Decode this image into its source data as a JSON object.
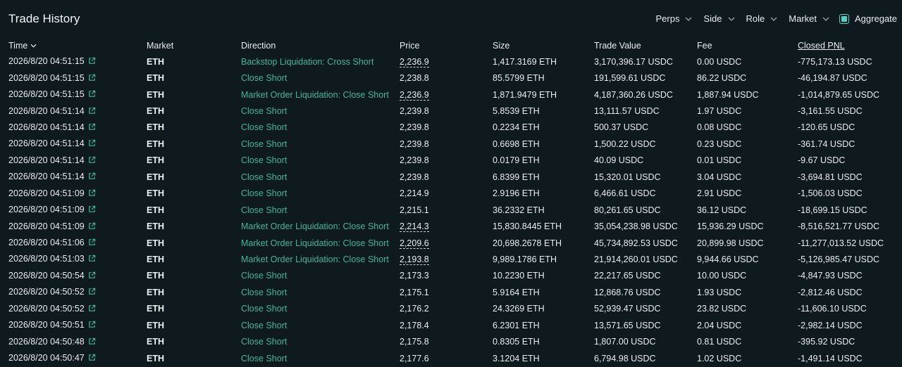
{
  "header": {
    "title": "Trade History",
    "filters": [
      "Perps",
      "Side",
      "Role",
      "Market"
    ],
    "aggregate_label": "Aggregate",
    "aggregate_checked": true
  },
  "columns": [
    "Time",
    "Market",
    "Direction",
    "Price",
    "Size",
    "Trade Value",
    "Fee",
    "Closed PNL"
  ],
  "rows": [
    {
      "time": "2026/8/20 04:51:15",
      "market": "ETH",
      "direction": "Backstop Liquidation: Cross Short",
      "price": "2,236.9",
      "price_dashed": true,
      "size": "1,417.3169 ETH",
      "value": "3,170,396.17 USDC",
      "fee": "0.00 USDC",
      "pnl": "-775,173.13 USDC"
    },
    {
      "time": "2026/8/20 04:51:15",
      "market": "ETH",
      "direction": "Close Short",
      "price": "2,238.8",
      "price_dashed": false,
      "size": "85.5799 ETH",
      "value": "191,599.61 USDC",
      "fee": "86.22 USDC",
      "pnl": "-46,194.87 USDC"
    },
    {
      "time": "2026/8/20 04:51:15",
      "market": "ETH",
      "direction": "Market Order Liquidation: Close Short",
      "price": "2,236.9",
      "price_dashed": true,
      "size": "1,871.9479 ETH",
      "value": "4,187,360.26 USDC",
      "fee": "1,887.94 USDC",
      "pnl": "-1,014,879.65 USDC"
    },
    {
      "time": "2026/8/20 04:51:14",
      "market": "ETH",
      "direction": "Close Short",
      "price": "2,239.8",
      "price_dashed": false,
      "size": "5.8539 ETH",
      "value": "13,111.57 USDC",
      "fee": "1.97 USDC",
      "pnl": "-3,161.55 USDC"
    },
    {
      "time": "2026/8/20 04:51:14",
      "market": "ETH",
      "direction": "Close Short",
      "price": "2,239.8",
      "price_dashed": false,
      "size": "0.2234 ETH",
      "value": "500.37 USDC",
      "fee": "0.08 USDC",
      "pnl": "-120.65 USDC"
    },
    {
      "time": "2026/8/20 04:51:14",
      "market": "ETH",
      "direction": "Close Short",
      "price": "2,239.8",
      "price_dashed": false,
      "size": "0.6698 ETH",
      "value": "1,500.22 USDC",
      "fee": "0.23 USDC",
      "pnl": "-361.74 USDC"
    },
    {
      "time": "2026/8/20 04:51:14",
      "market": "ETH",
      "direction": "Close Short",
      "price": "2,239.8",
      "price_dashed": false,
      "size": "0.0179 ETH",
      "value": "40.09 USDC",
      "fee": "0.01 USDC",
      "pnl": "-9.67 USDC"
    },
    {
      "time": "2026/8/20 04:51:14",
      "market": "ETH",
      "direction": "Close Short",
      "price": "2,239.8",
      "price_dashed": false,
      "size": "6.8399 ETH",
      "value": "15,320.01 USDC",
      "fee": "3.04 USDC",
      "pnl": "-3,694.81 USDC"
    },
    {
      "time": "2026/8/20 04:51:09",
      "market": "ETH",
      "direction": "Close Short",
      "price": "2,214.9",
      "price_dashed": false,
      "size": "2.9196 ETH",
      "value": "6,466.61 USDC",
      "fee": "2.91 USDC",
      "pnl": "-1,506.03 USDC"
    },
    {
      "time": "2026/8/20 04:51:09",
      "market": "ETH",
      "direction": "Close Short",
      "price": "2,215.1",
      "price_dashed": false,
      "size": "36.2332 ETH",
      "value": "80,261.65 USDC",
      "fee": "36.12 USDC",
      "pnl": "-18,699.15 USDC"
    },
    {
      "time": "2026/8/20 04:51:09",
      "market": "ETH",
      "direction": "Market Order Liquidation: Close Short",
      "price": "2,214.3",
      "price_dashed": true,
      "size": "15,830.8445 ETH",
      "value": "35,054,238.98 USDC",
      "fee": "15,936.29 USDC",
      "pnl": "-8,516,521.77 USDC"
    },
    {
      "time": "2026/8/20 04:51:06",
      "market": "ETH",
      "direction": "Market Order Liquidation: Close Short",
      "price": "2,209.6",
      "price_dashed": true,
      "size": "20,698.2678 ETH",
      "value": "45,734,892.53 USDC",
      "fee": "20,899.98 USDC",
      "pnl": "-11,277,013.52 USDC"
    },
    {
      "time": "2026/8/20 04:51:03",
      "market": "ETH",
      "direction": "Market Order Liquidation: Close Short",
      "price": "2,193.8",
      "price_dashed": true,
      "size": "9,989.1786 ETH",
      "value": "21,914,260.01 USDC",
      "fee": "9,944.66 USDC",
      "pnl": "-5,126,985.47 USDC"
    },
    {
      "time": "2026/8/20 04:50:54",
      "market": "ETH",
      "direction": "Close Short",
      "price": "2,173.3",
      "price_dashed": false,
      "size": "10.2230 ETH",
      "value": "22,217.65 USDC",
      "fee": "10.00 USDC",
      "pnl": "-4,847.93 USDC"
    },
    {
      "time": "2026/8/20 04:50:52",
      "market": "ETH",
      "direction": "Close Short",
      "price": "2,175.1",
      "price_dashed": false,
      "size": "5.9164 ETH",
      "value": "12,868.76 USDC",
      "fee": "1.93 USDC",
      "pnl": "-2,812.46 USDC"
    },
    {
      "time": "2026/8/20 04:50:52",
      "market": "ETH",
      "direction": "Close Short",
      "price": "2,176.2",
      "price_dashed": false,
      "size": "24.3269 ETH",
      "value": "52,939.47 USDC",
      "fee": "23.82 USDC",
      "pnl": "-11,606.10 USDC"
    },
    {
      "time": "2026/8/20 04:50:51",
      "market": "ETH",
      "direction": "Close Short",
      "price": "2,178.4",
      "price_dashed": false,
      "size": "6.2301 ETH",
      "value": "13,571.65 USDC",
      "fee": "2.04 USDC",
      "pnl": "-2,982.14 USDC"
    },
    {
      "time": "2026/8/20 04:50:48",
      "market": "ETH",
      "direction": "Close Short",
      "price": "2,175.8",
      "price_dashed": false,
      "size": "0.8305 ETH",
      "value": "1,807.00 USDC",
      "fee": "0.81 USDC",
      "pnl": "-395.92 USDC"
    },
    {
      "time": "2026/8/20 04:50:47",
      "market": "ETH",
      "direction": "Close Short",
      "price": "2,177.6",
      "price_dashed": false,
      "size": "3.1204 ETH",
      "value": "6,794.98 USDC",
      "fee": "1.02 USDC",
      "pnl": "-1,491.14 USDC"
    }
  ],
  "colors": {
    "background": "#0f1a1f",
    "accent": "#50d2c1",
    "direction_text": "#3fb896",
    "text": "#e9eef0"
  },
  "icons": {
    "external_link": "external-link-icon",
    "chevron": "chevron-down-icon",
    "checkbox": "checkbox-icon"
  }
}
